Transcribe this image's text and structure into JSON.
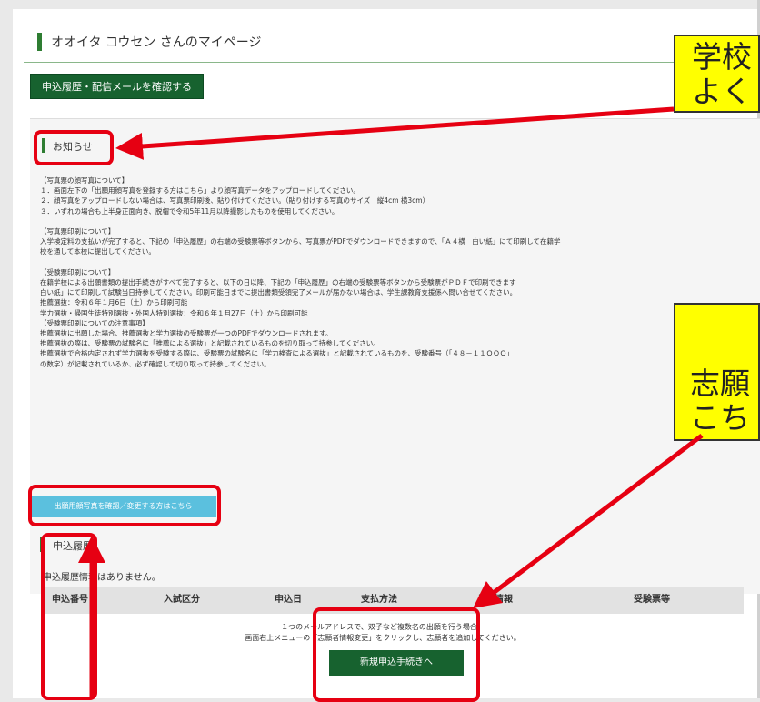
{
  "header": {
    "title": "オオイタ コウセン さんのマイページ"
  },
  "buttons": {
    "history": "申込履歴・配信メールを確認する",
    "photo": "出願用顔写真を確認／変更する方はこちら",
    "new_application": "新規申込手続きへ"
  },
  "notice": {
    "title": "お知らせ",
    "lines": [
      "【写真票の顔写真について】",
      "１．画面左下の「出願用顔写真を登録する方はこちら」より顔写真データをアップロードしてください。",
      "２．顔写真をアップロードしない場合は、写真票印刷後、貼り付けてください。（貼り付けする写真のサイズ　縦4cm 横3cm）",
      "３．いずれの場合も上半身正面向き、脱帽で令和5年11月以降撮影したものを使用してください。",
      "",
      "【写真票印刷について】",
      "入学検定料の支払いが完了すると、下記の「申込履歴」の右端の受験票等ボタンから、写真票がPDFでダウンロードできますので、「Ａ４横　白い紙」にて印刷して在籍学",
      "校を通して本校に提出してください。",
      "",
      "【受験票印刷について】",
      "在籍学校による出願書類の提出手続きがすべて完了すると、以下の日以降、下記の「申込履歴」の右端の受験票等ボタンから受験票がＰＤＦで印刷できます",
      "白い紙」にて印刷して試験当日持参してください。印刷可能日までに提出書類受領完了メールが届かない場合は、学生課教育支援係へ問い合せてください。",
      "推薦選抜：令和６年１月6日（土）から印刷可能",
      "学力選抜・帰国生徒特別選抜・外国人特別選抜：令和６年１月27日（土）から印刷可能",
      "【受験票印刷についての注意事項】",
      "推薦選抜に出願した場合、推薦選抜と学力選抜の受験票が一つのPDFでダウンロードされます。",
      "推薦選抜の際は、受験票の試験名に「推薦による選抜」と記載されているものを切り取って持参してください。",
      "推薦選抜で合格内定されず学力選抜を受験する際は、受験票の試験名に「学力検査による選抜」と記載されているものを、受験番号（「４８－１１ＯＯＯ」",
      "の数字）が記載されているか、必ず確認して切り取って持参してください。"
    ]
  },
  "history": {
    "title": "申込履歴",
    "empty_message": "申込履歴情報はありません。",
    "columns": [
      "申込番号",
      "入試区分",
      "申込日",
      "支払方法",
      "入金情報",
      "受験票等"
    ]
  },
  "footer": {
    "line1": "１つのメールアドレスで、双子など複数名の出願を行う場合、",
    "line2": "画面右上メニューの「志願者情報変更」をクリックし、志願者を追加してください。"
  },
  "callouts": {
    "top": [
      "学校",
      "よく"
    ],
    "middle": [
      "志願",
      "こち"
    ]
  },
  "colors": {
    "accent": "#17622f",
    "info": "#5bc0de",
    "highlight": "#ffff00",
    "annotation": "#e60012"
  }
}
